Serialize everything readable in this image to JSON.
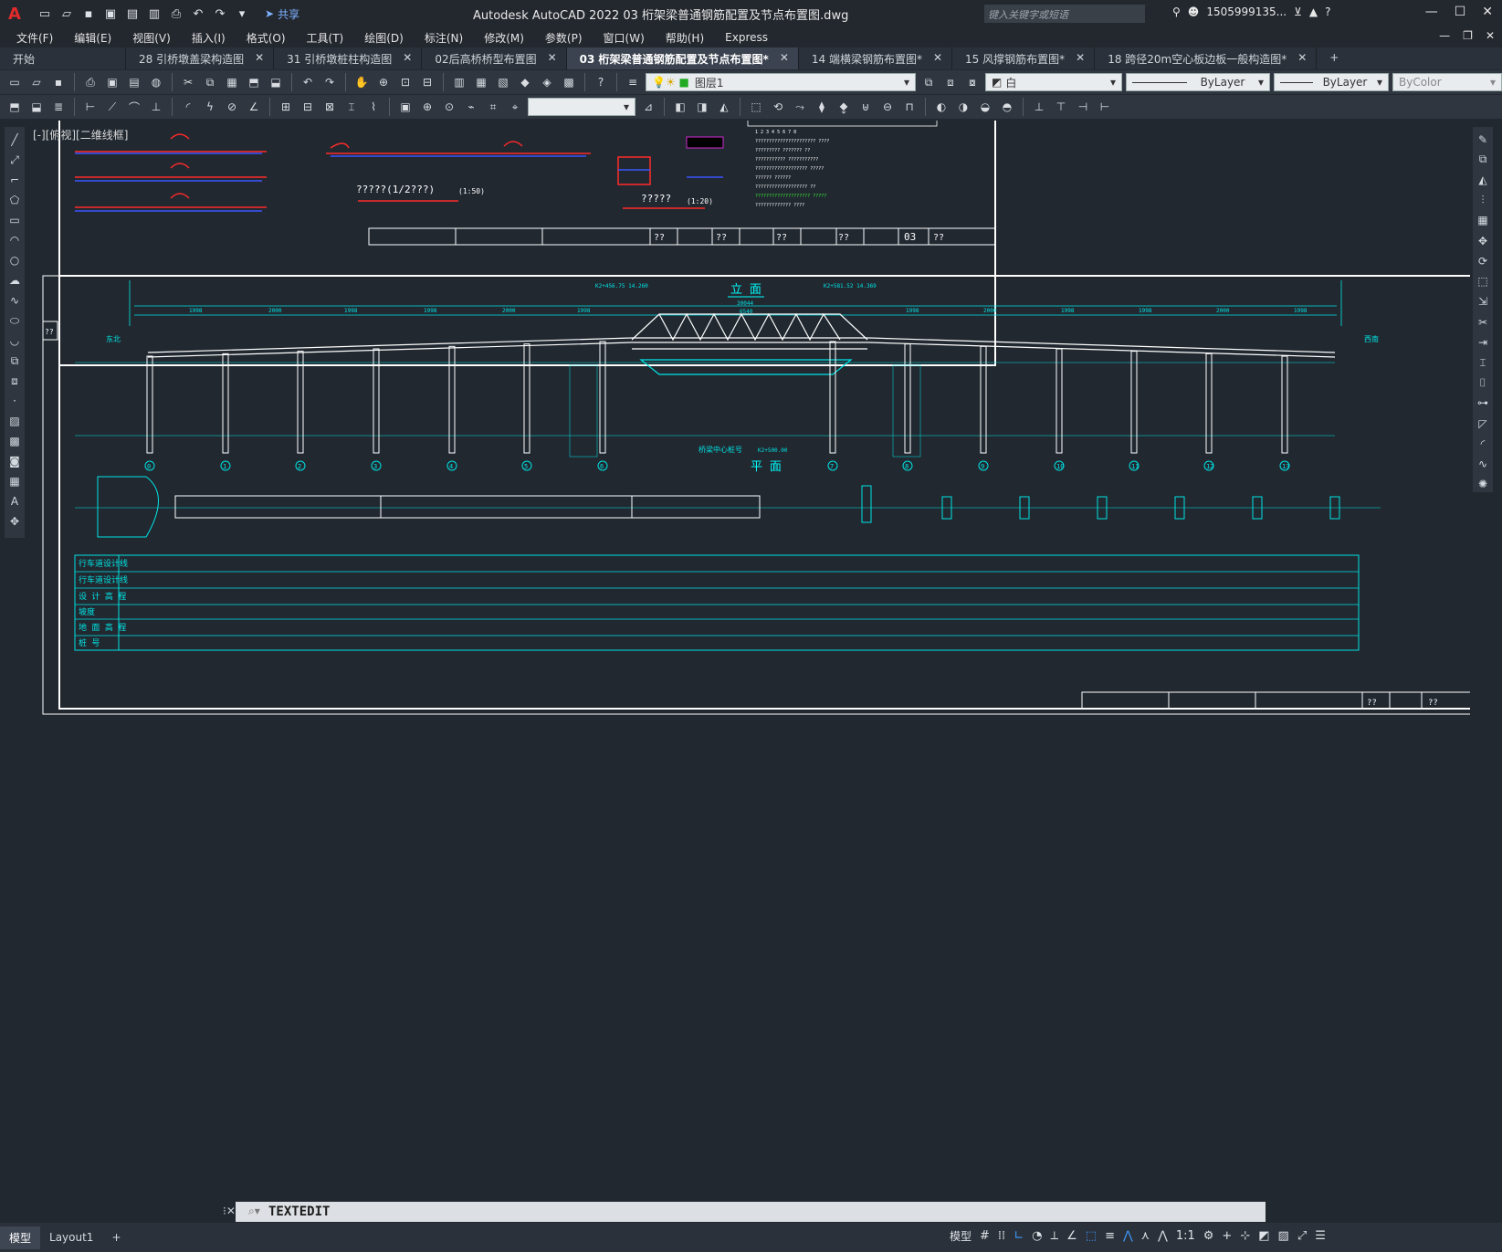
{
  "app": {
    "logo": "A",
    "title": "Autodesk AutoCAD 2022    03 桁架梁普通钢筋配置及节点布置图.dwg",
    "share_label": "共享",
    "search_placeholder": "键入关键字或短语",
    "user": "1505999135...",
    "viewport_label": "[-][俯视][二维线框]"
  },
  "menu": [
    "文件(F)",
    "编辑(E)",
    "视图(V)",
    "插入(I)",
    "格式(O)",
    "工具(T)",
    "绘图(D)",
    "标注(N)",
    "修改(M)",
    "参数(P)",
    "窗口(W)",
    "帮助(H)",
    "Express"
  ],
  "tabs": [
    {
      "label": "开始",
      "closable": false,
      "active": false
    },
    {
      "label": "28 引桥墩盖梁构造图",
      "closable": true,
      "active": false
    },
    {
      "label": "31 引桥墩桩柱构造图",
      "closable": true,
      "active": false
    },
    {
      "label": "02后高桥桥型布置图",
      "closable": true,
      "active": false
    },
    {
      "label": "03 桁架梁普通钢筋配置及节点布置图*",
      "closable": true,
      "active": true
    },
    {
      "label": "14 端横梁钢筋布置图*",
      "closable": true,
      "active": false
    },
    {
      "label": "15 风撑钢筋布置图*",
      "closable": true,
      "active": false
    },
    {
      "label": "18 跨径20m空心板边板一般构造图*",
      "closable": true,
      "active": false
    }
  ],
  "properties": {
    "layer": "图层1",
    "color": "白",
    "linetype": "ByLayer",
    "lineweight": "ByLayer",
    "plotstyle": "ByColor"
  },
  "command": {
    "text": "TEXTEDIT"
  },
  "layouts": [
    "模型",
    "Layout1"
  ],
  "status": {
    "model": "模型",
    "scale": "1:1"
  },
  "drawing": {
    "elevation_title": "立 面",
    "plan_title": "平 面",
    "sheet_no": "03",
    "upper_note": "?????(1/2???)",
    "upper_note2": "?????",
    "bridge_center_label": "桥梁中心桩号",
    "left_label": "东北",
    "right_label": "西南",
    "table_rows": [
      "行车道设计线",
      "行车道设计线",
      "设 计 高 程",
      "坡度",
      "地 面 高 程",
      "桩 号"
    ],
    "pier_numbers": [
      "0",
      "1",
      "2",
      "3",
      "4",
      "5",
      "6",
      "7",
      "8",
      "9",
      "10",
      "11",
      "12",
      "13"
    ]
  }
}
